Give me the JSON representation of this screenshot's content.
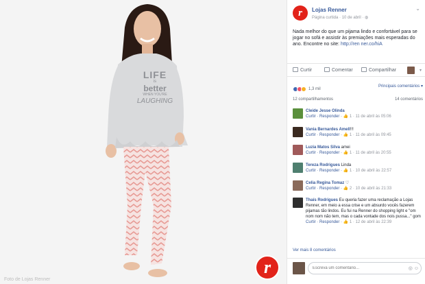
{
  "photo": {
    "caption": "Foto de Lojas Renner",
    "shirt_text": [
      "LIFE",
      "is",
      "better",
      "WHEN YOU'RE",
      "LAUGHING"
    ],
    "watermark_letter": "r"
  },
  "post": {
    "page_name": "Lojas Renner",
    "meta": "Página curtida · 10 de abril · ",
    "logo_letter": "r",
    "text": "Nada melhor do que um pijama lindo e confortável para se jogar no sofá e assistir às premiações mais esperadas do ano. Encontre no site: ",
    "link": "http://ren ner.co/hiA"
  },
  "actions": {
    "like": "Curtir",
    "comment": "Comentar",
    "share": "Compartilhar"
  },
  "reactions": {
    "count": "1,3 mil",
    "filter": "Principais comentários ▾",
    "colors": {
      "like": "#4267b2",
      "love": "#f25268",
      "haha": "#f7b125"
    }
  },
  "shares": {
    "shares_text": "12 compartilhamentos",
    "comments_text": "14 comentários"
  },
  "comments": [
    {
      "name": "Cleide Jesse Olinda",
      "text": "",
      "meta_prefix": "Curtir · Responder · ",
      "meta_suffix": " 1 · 11 de abril às 05:06",
      "avatar": "#5a8f3c"
    },
    {
      "name": "Vania Bernardes Amell",
      "text": "!!!",
      "meta_prefix": "Curtir · Responder · ",
      "meta_suffix": " 1 · 11 de abril às 09:45",
      "avatar": "#3b2a20"
    },
    {
      "name": "Luzia Matos Silva",
      "text": " amei",
      "meta_prefix": "Curtir · Responder · ",
      "meta_suffix": " 1 · 11 de abril às 20:55",
      "avatar": "#a05a5a"
    },
    {
      "name": "Tereza Rodrigues",
      "text": " Linda",
      "meta_prefix": "Curtir · Responder · ",
      "meta_suffix": " 1 · 10 de abril às 22:57",
      "avatar": "#4f7f6f"
    },
    {
      "name": "Celia Regina Tomaz",
      "text": " ♡",
      "meta_prefix": "Curtir · Responder · ",
      "meta_suffix": " 2 · 10 de abril às 21:33",
      "avatar": "#8a6a5a"
    },
    {
      "name": "Thaís Rodrigues",
      "text": " Eu queria fazer uma reclamação a Lojas Renner, em meio a essa crise e um absurdo vocês fazerem pijamas tão lindos. Eu fui na Renner do shopping light e \"om nom nom não tem, mas o cada vontade dos nois pussa...\" gom",
      "meta_prefix": "Curtir · Responder · ",
      "meta_suffix": " 1 · 12 de abril às 22:39",
      "avatar": "#2e2e2e"
    }
  ],
  "view_more": "Ver mais 8 comentários",
  "composer": {
    "placeholder": "Escreva um comentário...",
    "icons": "◎ ☺"
  }
}
